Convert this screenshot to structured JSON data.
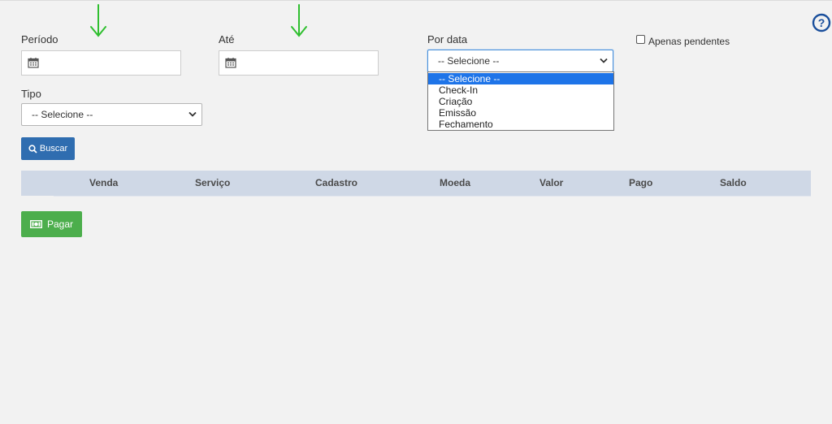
{
  "filters": {
    "periodo_label": "Período",
    "ate_label": "Até",
    "por_data_label": "Por data",
    "apenas_pendentes_label": "Apenas pendentes",
    "tipo_label": "Tipo"
  },
  "por_data_select": {
    "selected": "-- Selecione --",
    "options": [
      "-- Selecione --",
      "Check-In",
      "Criação",
      "Emissão",
      "Fechamento"
    ]
  },
  "tipo_select": {
    "selected": "-- Selecione --"
  },
  "buttons": {
    "buscar": "Buscar",
    "pagar": "Pagar"
  },
  "table": {
    "headers": [
      "Venda",
      "Serviço",
      "Cadastro",
      "Moeda",
      "Valor",
      "Pago",
      "Saldo"
    ]
  },
  "colors": {
    "primary_button": "#2f6db0",
    "success_button": "#4cae4c",
    "table_header_bg": "#cfd8e6",
    "annotation_arrow": "#2fbf2f",
    "help_icon": "#1a4f9c"
  },
  "icons": {
    "calendar": "calendar-icon",
    "search": "search-icon",
    "money": "money-icon",
    "help": "help-icon",
    "arrow": "arrow-down-icon"
  }
}
